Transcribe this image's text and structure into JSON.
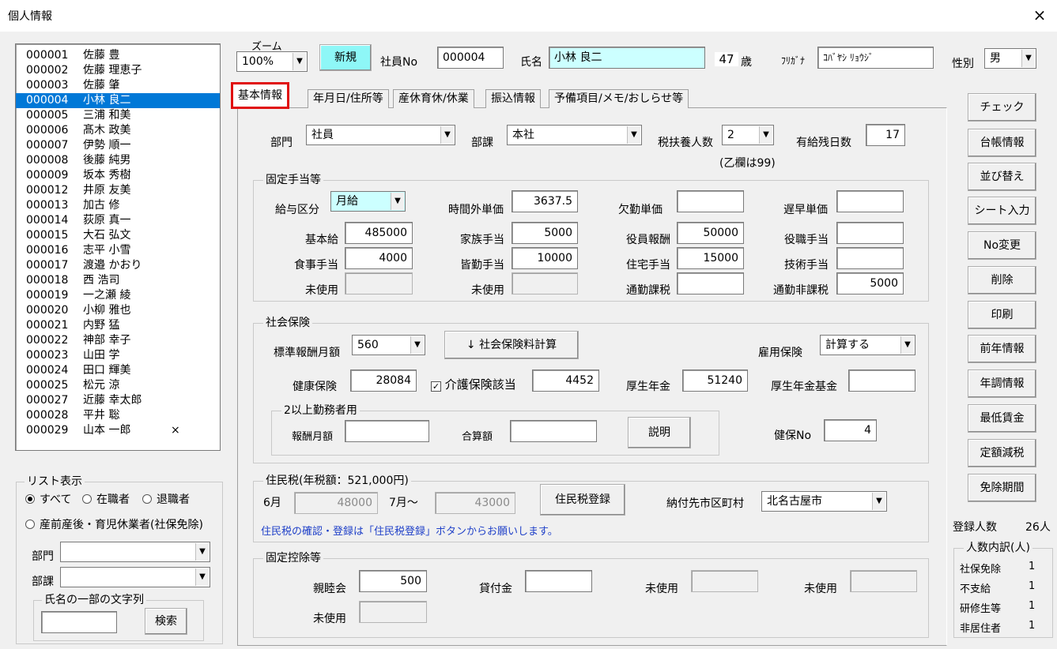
{
  "window": {
    "title": "個人情報",
    "close": "×"
  },
  "employees": [
    {
      "no": "000001",
      "name": "佐藤 豊",
      "mark": ""
    },
    {
      "no": "000002",
      "name": "佐藤 理恵子",
      "mark": ""
    },
    {
      "no": "000003",
      "name": "佐藤 肇",
      "mark": ""
    },
    {
      "no": "000004",
      "name": "小林 良二",
      "mark": "",
      "selected": true
    },
    {
      "no": "000005",
      "name": "三浦 和美",
      "mark": ""
    },
    {
      "no": "000006",
      "name": "髙木 政美",
      "mark": ""
    },
    {
      "no": "000007",
      "name": "伊勢 順一",
      "mark": ""
    },
    {
      "no": "000008",
      "name": "後藤 純男",
      "mark": ""
    },
    {
      "no": "000009",
      "name": "坂本 秀樹",
      "mark": ""
    },
    {
      "no": "000012",
      "name": "井原 友美",
      "mark": ""
    },
    {
      "no": "000013",
      "name": "加古 修",
      "mark": ""
    },
    {
      "no": "000014",
      "name": "荻原 真一",
      "mark": ""
    },
    {
      "no": "000015",
      "name": "大石 弘文",
      "mark": ""
    },
    {
      "no": "000016",
      "name": "志平 小雪",
      "mark": ""
    },
    {
      "no": "000017",
      "name": "渡邉 かおり",
      "mark": ""
    },
    {
      "no": "000018",
      "name": "西 浩司",
      "mark": ""
    },
    {
      "no": "000019",
      "name": "一之瀬 綾",
      "mark": ""
    },
    {
      "no": "000020",
      "name": "小柳 雅也",
      "mark": ""
    },
    {
      "no": "000021",
      "name": "内野 猛",
      "mark": ""
    },
    {
      "no": "000022",
      "name": "神部 幸子",
      "mark": ""
    },
    {
      "no": "000023",
      "name": "山田 学",
      "mark": ""
    },
    {
      "no": "000024",
      "name": "田口 輝美",
      "mark": ""
    },
    {
      "no": "000025",
      "name": "松元 涼",
      "mark": ""
    },
    {
      "no": "000027",
      "name": "近藤 幸太郎",
      "mark": ""
    },
    {
      "no": "000028",
      "name": "平井 聡",
      "mark": ""
    },
    {
      "no": "000029",
      "name": "山本 一郎",
      "mark": "×"
    }
  ],
  "list_filter": {
    "title": "リスト表示",
    "opt_all": "すべて",
    "opt_active": "在職者",
    "opt_retired": "退職者",
    "opt_leave": "産前産後・育児休業者(社保免除)",
    "dept_label": "部門",
    "section_label": "部課",
    "dept_value": "",
    "section_value": "",
    "name_search_title": "氏名の一部の文字列",
    "name_search_value": "",
    "search_button": "検索"
  },
  "header": {
    "zoom_label": "ズーム",
    "zoom_value": "100%",
    "new_button": "新規",
    "empno_label": "社員No",
    "empno_value": "000004",
    "name_label": "氏名",
    "name_value": "小林 良二",
    "age_value": "47",
    "age_unit": "歳",
    "kana_label": "ﾌﾘｶﾞﾅ",
    "kana_value": "ｺﾊﾞﾔｼ ﾘｮｳｼﾞ",
    "gender_label": "性別",
    "gender_value": "男"
  },
  "tabs": [
    "基本情報",
    "年月日/住所等",
    "産休育休/休業",
    "振込情報",
    "予備項目/メモ/おしらせ等"
  ],
  "basic": {
    "dept_label": "部門",
    "dept_value": "社員",
    "section_label": "部課",
    "section_value": "本社",
    "dependents_label": "税扶養人数",
    "dependents_value": "2",
    "dependents_note": "(乙欄は99)",
    "paid_leave_label": "有給残日数",
    "paid_leave_value": "17"
  },
  "allowances": {
    "title": "固定手当等",
    "pay_type_label": "給与区分",
    "pay_type_value": "月給",
    "overtime_label": "時間外単価",
    "overtime_value": "3637.5",
    "absence_label": "欠勤単価",
    "absence_value": "",
    "late_label": "遅早単価",
    "late_value": "",
    "base_label": "基本給",
    "base_value": "485000",
    "family_label": "家族手当",
    "family_value": "5000",
    "officer_label": "役員報酬",
    "officer_value": "50000",
    "position_label": "役職手当",
    "position_value": "",
    "meal_label": "食事手当",
    "meal_value": "4000",
    "attendance_label": "皆勤手当",
    "attendance_value": "10000",
    "housing_label": "住宅手当",
    "housing_value": "15000",
    "skill_label": "技術手当",
    "skill_value": "",
    "unused1_label": "未使用",
    "unused1_value": "",
    "unused2_label": "未使用",
    "unused2_value": "",
    "commute_tax_label": "通勤課税",
    "commute_tax_value": "",
    "commute_free_label": "通勤非課税",
    "commute_free_value": "5000"
  },
  "insurance": {
    "title": "社会保険",
    "std_monthly_label": "標準報酬月額",
    "std_monthly_value": "560",
    "calc_button": "↓ 社会保険料計算",
    "employment_label": "雇用保険",
    "employment_value": "計算する",
    "health_label": "健康保険",
    "health_value": "28084",
    "care_label": "介護保険該当",
    "care_checked": "✓",
    "care_value": "4452",
    "pension_label": "厚生年金",
    "pension_value": "51240",
    "pension_fund_label": "厚生年金基金",
    "pension_fund_value": "",
    "multi_title": "2以上勤務者用",
    "multi_pay_label": "報酬月額",
    "multi_pay_value": "",
    "multi_total_label": "合算額",
    "multi_total_value": "",
    "explain_button": "説明",
    "health_no_label": "健保No",
    "health_no_value": "4"
  },
  "resident_tax": {
    "title": "住民税(年税額：521,000円)",
    "june_label": "6月",
    "june_value": "48000",
    "july_label": "7月～",
    "july_value": "43000",
    "register_button": "住民税登録",
    "city_label": "納付先市区町村",
    "city_value": "北名古屋市",
    "note": "住民税の確認・登録は「住民税登録」ボタンからお願いします。"
  },
  "deductions": {
    "title": "固定控除等",
    "social_label": "親睦会",
    "social_value": "500",
    "loan_label": "貸付金",
    "loan_value": "",
    "unused_a_label": "未使用",
    "unused_a_value": "",
    "unused_b_label": "未使用",
    "unused_b_value": "",
    "unused_c_label": "未使用",
    "unused_c_value": ""
  },
  "side_buttons": [
    "チェック",
    "台帳情報",
    "並び替え",
    "シート入力",
    "No変更",
    "削除",
    "印刷",
    "前年情報",
    "年調情報",
    "最低賃金",
    "定額減税",
    "免除期間"
  ],
  "stats": {
    "registered_label": "登録人数",
    "registered_value": "26人",
    "breakdown_title": "人数内訳(人)",
    "rows": [
      {
        "label": "社保免除",
        "value": "1"
      },
      {
        "label": "不支給",
        "value": "1"
      },
      {
        "label": "研修生等",
        "value": "1"
      },
      {
        "label": "非居住者",
        "value": "1"
      }
    ]
  }
}
